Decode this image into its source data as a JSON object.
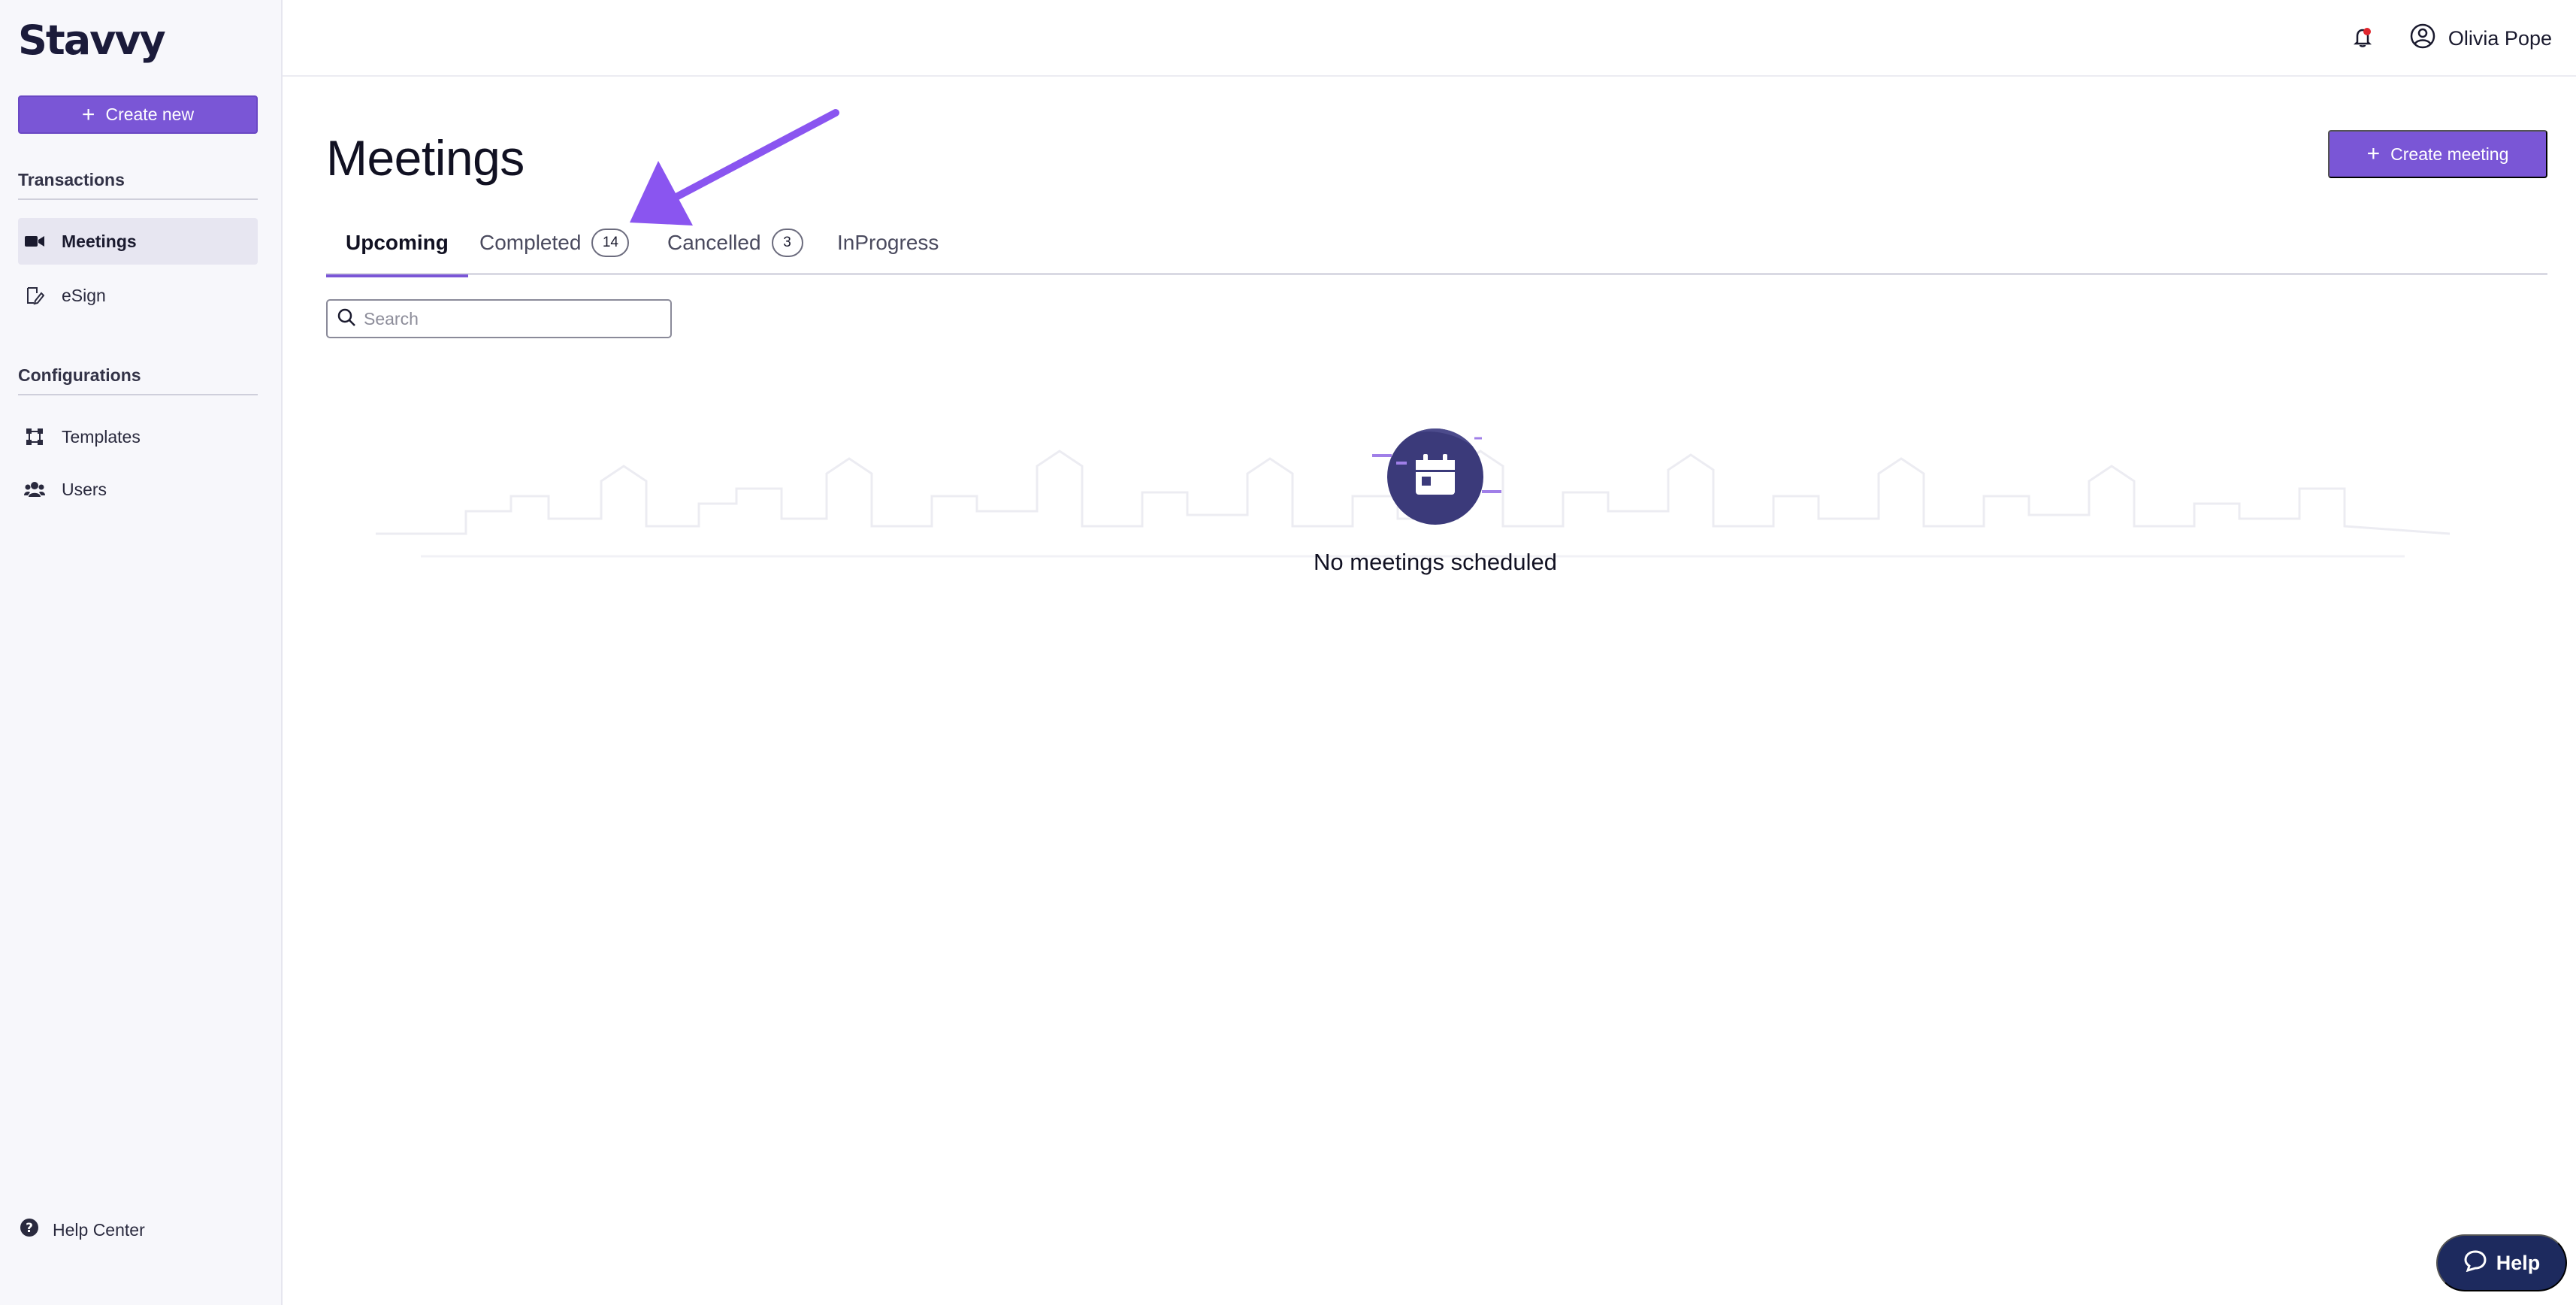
{
  "app": {
    "logo": "Stavvy"
  },
  "sidebar": {
    "create_new_label": "Create new",
    "sections": [
      {
        "title": "Transactions",
        "items": [
          {
            "label": "Meetings",
            "icon": "video-camera-icon",
            "active": true
          },
          {
            "label": "eSign",
            "icon": "signature-icon",
            "active": false
          }
        ]
      },
      {
        "title": "Configurations",
        "items": [
          {
            "label": "Templates",
            "icon": "frame-icon",
            "active": false
          },
          {
            "label": "Users",
            "icon": "users-icon",
            "active": false
          }
        ]
      }
    ],
    "help_center_label": "Help Center"
  },
  "topbar": {
    "user_name": "Olivia Pope"
  },
  "main": {
    "title": "Meetings",
    "create_meeting_label": "Create meeting",
    "tabs": [
      {
        "label": "Upcoming",
        "badge": "",
        "active": true
      },
      {
        "label": "Completed",
        "badge": "14",
        "active": false
      },
      {
        "label": "Cancelled",
        "badge": "3",
        "active": false
      },
      {
        "label": "InProgress",
        "badge": "",
        "active": false
      }
    ],
    "search": {
      "placeholder": "Search",
      "value": ""
    },
    "empty_state": "No meetings scheduled"
  },
  "help_button_label": "Help",
  "colors": {
    "accent": "#7a56d6",
    "navy": "#1d2a5e",
    "empty_icon_bg": "#3b3a7a",
    "notification_dot": "#e0262e"
  }
}
